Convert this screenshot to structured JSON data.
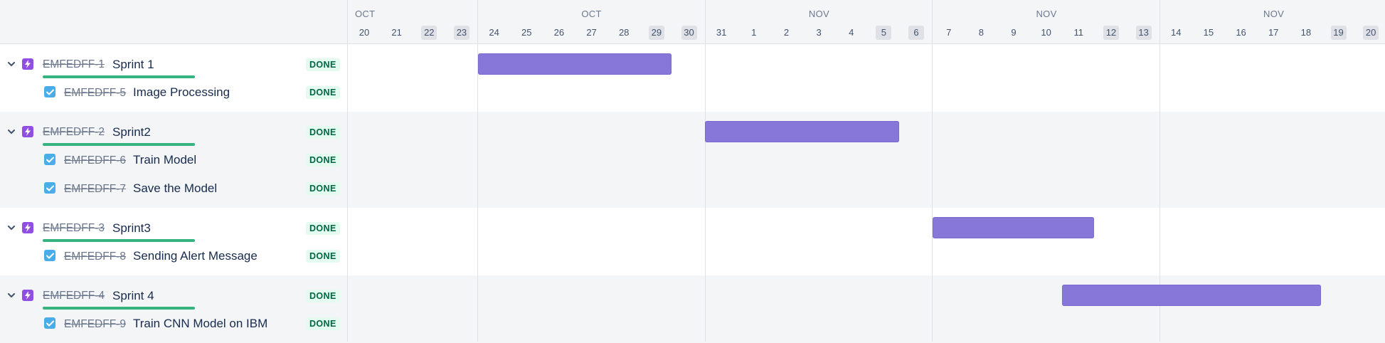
{
  "timeline": {
    "weeks": [
      {
        "month": "OCT",
        "days": [
          {
            "d": "20",
            "weekend": false
          },
          {
            "d": "21",
            "weekend": false
          },
          {
            "d": "22",
            "weekend": true
          },
          {
            "d": "23",
            "weekend": true
          }
        ]
      },
      {
        "month": "OCT",
        "days": [
          {
            "d": "24",
            "weekend": false
          },
          {
            "d": "25",
            "weekend": false
          },
          {
            "d": "26",
            "weekend": false
          },
          {
            "d": "27",
            "weekend": false
          },
          {
            "d": "28",
            "weekend": false
          },
          {
            "d": "29",
            "weekend": true
          },
          {
            "d": "30",
            "weekend": true
          }
        ]
      },
      {
        "month": "NOV",
        "days": [
          {
            "d": "31",
            "weekend": false
          },
          {
            "d": "1",
            "weekend": false
          },
          {
            "d": "2",
            "weekend": false
          },
          {
            "d": "3",
            "weekend": false
          },
          {
            "d": "4",
            "weekend": false
          },
          {
            "d": "5",
            "weekend": true
          },
          {
            "d": "6",
            "weekend": true
          }
        ]
      },
      {
        "month": "NOV",
        "days": [
          {
            "d": "7",
            "weekend": false
          },
          {
            "d": "8",
            "weekend": false
          },
          {
            "d": "9",
            "weekend": false
          },
          {
            "d": "10",
            "weekend": false
          },
          {
            "d": "11",
            "weekend": false
          },
          {
            "d": "12",
            "weekend": true
          },
          {
            "d": "13",
            "weekend": true
          }
        ]
      },
      {
        "month": "NOV",
        "days": [
          {
            "d": "14",
            "weekend": false
          },
          {
            "d": "15",
            "weekend": false
          },
          {
            "d": "16",
            "weekend": false
          },
          {
            "d": "17",
            "weekend": false
          },
          {
            "d": "18",
            "weekend": false
          },
          {
            "d": "19",
            "weekend": true
          },
          {
            "d": "20",
            "weekend": true
          }
        ]
      }
    ]
  },
  "epics": [
    {
      "key": "EMFEDFF-1",
      "title": "Sprint 1",
      "status": "DONE",
      "progress": 1.0,
      "bar": {
        "start": "Oct 24",
        "end": "Oct 29"
      },
      "icon": "epic-lightning-icon",
      "children": [
        {
          "key": "EMFEDFF-5",
          "title": "Image Processing",
          "status": "DONE",
          "icon": "task-checkbox-icon"
        }
      ]
    },
    {
      "key": "EMFEDFF-2",
      "title": "Sprint2",
      "status": "DONE",
      "progress": 1.0,
      "bar": {
        "start": "Oct 31",
        "end": "Nov 5"
      },
      "icon": "epic-lightning-icon",
      "children": [
        {
          "key": "EMFEDFF-6",
          "title": "Train Model",
          "status": "DONE",
          "icon": "task-checkbox-icon"
        },
        {
          "key": "EMFEDFF-7",
          "title": "Save the Model",
          "status": "DONE",
          "icon": "task-checkbox-icon"
        }
      ]
    },
    {
      "key": "EMFEDFF-3",
      "title": "Sprint3",
      "status": "DONE",
      "progress": 1.0,
      "bar": {
        "start": "Nov 7",
        "end": "Nov 11"
      },
      "icon": "epic-lightning-icon",
      "children": [
        {
          "key": "EMFEDFF-8",
          "title": "Sending Alert Message",
          "status": "DONE",
          "icon": "task-checkbox-icon"
        }
      ]
    },
    {
      "key": "EMFEDFF-4",
      "title": "Sprint 4",
      "status": "DONE",
      "progress": 1.0,
      "bar": {
        "start": "Nov 11",
        "end": "Nov 18"
      },
      "icon": "epic-lightning-icon",
      "children": [
        {
          "key": "EMFEDFF-9",
          "title": "Train CNN Model on IBM",
          "status": "DONE",
          "icon": "task-checkbox-icon"
        }
      ]
    }
  ],
  "colors": {
    "epic_bar": "#8777d9",
    "done_badge_bg": "#e3fcef",
    "done_badge_text": "#006644",
    "progress": "#36b37e",
    "epic_icon": "#904ee2",
    "task_icon": "#4bade8"
  }
}
